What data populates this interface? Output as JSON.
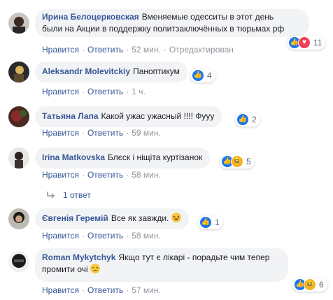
{
  "colors": {
    "author": "#385898",
    "bubble": "#f2f3f5",
    "meta": "#90949c",
    "like": "#1877f2",
    "love": "#f33e58",
    "haha": "#f7b125"
  },
  "comments": [
    {
      "author": "Ирина Белоцерковская",
      "text_line1": "Вменяемые одесситы в этот день",
      "text_line2": "были на Акции в поддержку политзаключённых в тюрьмах рф",
      "like": "Нравится",
      "reply": "Ответить",
      "time": "52 мин.",
      "edited": "Отредактирован",
      "reactions": [
        "like-icon",
        "love-icon"
      ],
      "reaction_count": "11"
    },
    {
      "author": "Aleksandr Molevitckiy",
      "text": "Паноптикум",
      "like": "Нравится",
      "reply": "Ответить",
      "time": "1 ч.",
      "reactions": [
        "like-icon"
      ],
      "reaction_count": "4"
    },
    {
      "author": "Татьяна Лапа",
      "text": "Какой ужас ужасный !!!! Фууу",
      "like": "Нравится",
      "reply": "Ответить",
      "time": "59 мин.",
      "reactions": [
        "like-icon"
      ],
      "reaction_count": "2"
    },
    {
      "author": "Irina Matkovska",
      "text": "Блєск і ніщіта куртізанок",
      "like": "Нравится",
      "reply": "Ответить",
      "time": "58 мин.",
      "reactions": [
        "like-icon",
        "haha-icon"
      ],
      "reaction_count": "5",
      "replies_link": "1 ответ"
    },
    {
      "author": "Євгенія Геремій",
      "text": "Все як завжди.",
      "emoji": "laughing-emoji",
      "like": "Нравится",
      "reply": "Ответить",
      "time": "58 мин.",
      "reactions": [
        "like-icon"
      ],
      "reaction_count": "1"
    },
    {
      "author": "Roman Mykytchyk",
      "text_line1": "Якщо тут є лікарі - порадьте чим тепер",
      "text_line2": "промити очі",
      "emoji": "disappointed-emoji",
      "like": "Нравится",
      "reply": "Ответить",
      "time": "57 мин.",
      "reactions": [
        "like-icon",
        "haha-icon"
      ],
      "reaction_count": "6"
    }
  ]
}
